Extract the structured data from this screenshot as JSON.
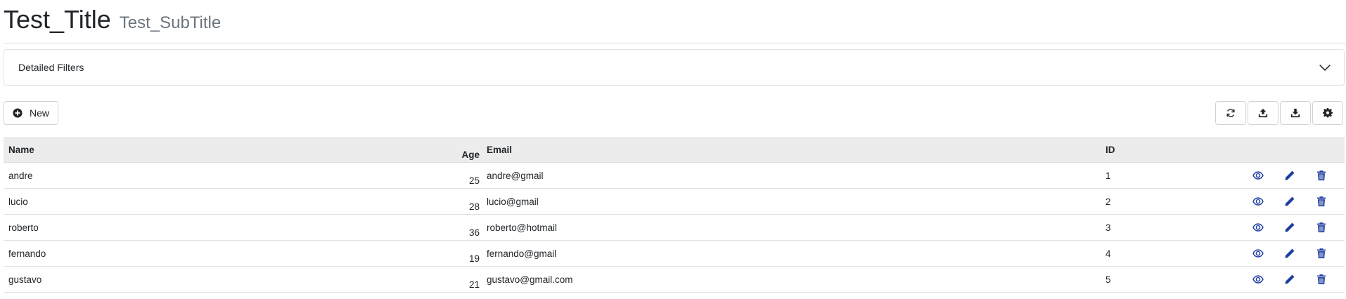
{
  "header": {
    "title": "Test_Title",
    "subtitle": "Test_SubTitle"
  },
  "filters": {
    "label": "Detailed Filters"
  },
  "toolbar": {
    "new_label": "New"
  },
  "table": {
    "columns": {
      "name": "Name",
      "age": "Age",
      "email": "Email",
      "id": "ID"
    },
    "rows": [
      {
        "name": "andre",
        "age": "25",
        "email": "andre@gmail",
        "id": "1"
      },
      {
        "name": "lucio",
        "age": "28",
        "email": "lucio@gmail",
        "id": "2"
      },
      {
        "name": "roberto",
        "age": "36",
        "email": "roberto@hotmail",
        "id": "3"
      },
      {
        "name": "fernando",
        "age": "19",
        "email": "fernando@gmail",
        "id": "4"
      },
      {
        "name": "gustavo",
        "age": "21",
        "email": "gustavo@gmail.com",
        "id": "5"
      }
    ]
  },
  "colors": {
    "header_bg": "#ececec",
    "action_icon": "#1f3f9f",
    "border": "#dee2e6"
  },
  "icons": {
    "new": "plus-circle-icon",
    "refresh": "refresh-icon",
    "upload": "upload-icon",
    "download": "download-icon",
    "settings": "gear-icon",
    "view": "eye-icon",
    "edit": "pencil-icon",
    "delete": "trash-icon",
    "expand": "chevron-down-icon"
  }
}
